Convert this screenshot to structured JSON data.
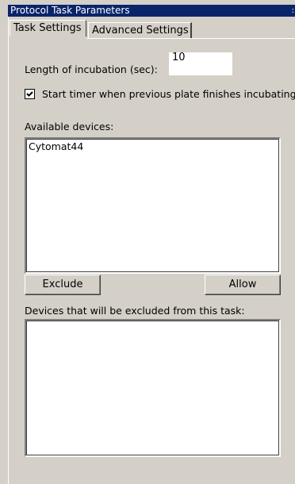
{
  "window": {
    "title": "Protocol Task Parameters"
  },
  "tabs": [
    {
      "label": "Task Settings",
      "active": true
    },
    {
      "label": "Advanced Settings",
      "active": false
    }
  ],
  "incubation": {
    "label": "Length of incubation (sec):",
    "value": "10"
  },
  "start_timer": {
    "label": "Start timer when previous plate finishes incubating",
    "checked": true
  },
  "available_devices": {
    "label": "Available devices:",
    "items": [
      "Cytomat44"
    ]
  },
  "buttons": {
    "exclude": "Exclude",
    "allow": "Allow"
  },
  "excluded_devices": {
    "label": "Devices that will be excluded from this task:",
    "items": []
  }
}
